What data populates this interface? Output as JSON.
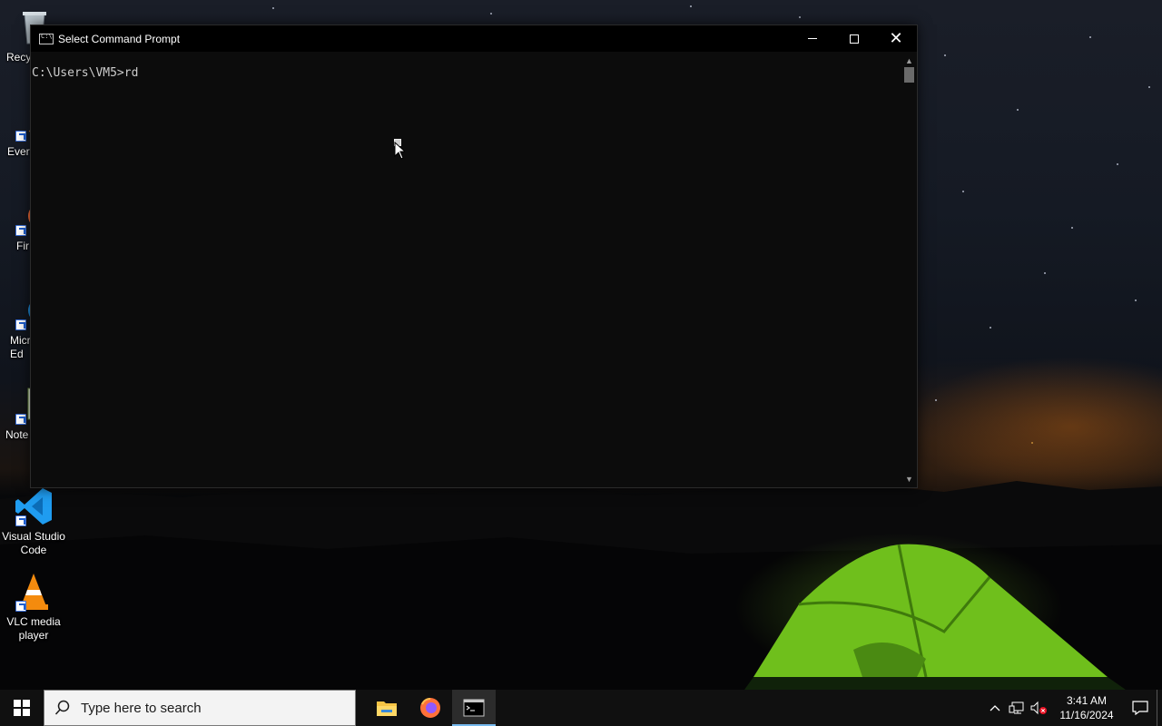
{
  "window": {
    "title": "Select Command Prompt",
    "console_lines": [
      "C:\\Users\\VM5>rd"
    ]
  },
  "desktop_icons": [
    {
      "label": "Recy",
      "icon": "recycle-bin-icon"
    },
    {
      "label": "Every",
      "icon": "everything-icon"
    },
    {
      "label": "Fir",
      "icon": "firefox-icon"
    },
    {
      "label": "Micr Ed",
      "icon": "edge-icon"
    },
    {
      "label": "Note",
      "icon": "notepad-plus-plus-icon"
    },
    {
      "label": "Visual Studio Code",
      "icon": "vscode-icon"
    },
    {
      "label": "VLC media player",
      "icon": "vlc-icon"
    }
  ],
  "taskbar": {
    "search_placeholder": "Type here to search",
    "apps": [
      "file-explorer-icon",
      "firefox-icon",
      "command-prompt-icon"
    ],
    "clock_time": "3:41 AM",
    "clock_date": "11/16/2024"
  },
  "colors": {
    "console_bg": "#0c0c0c",
    "console_text": "#cccccc",
    "taskbar_bg": "#101010",
    "active_indicator": "#76b9ed"
  }
}
